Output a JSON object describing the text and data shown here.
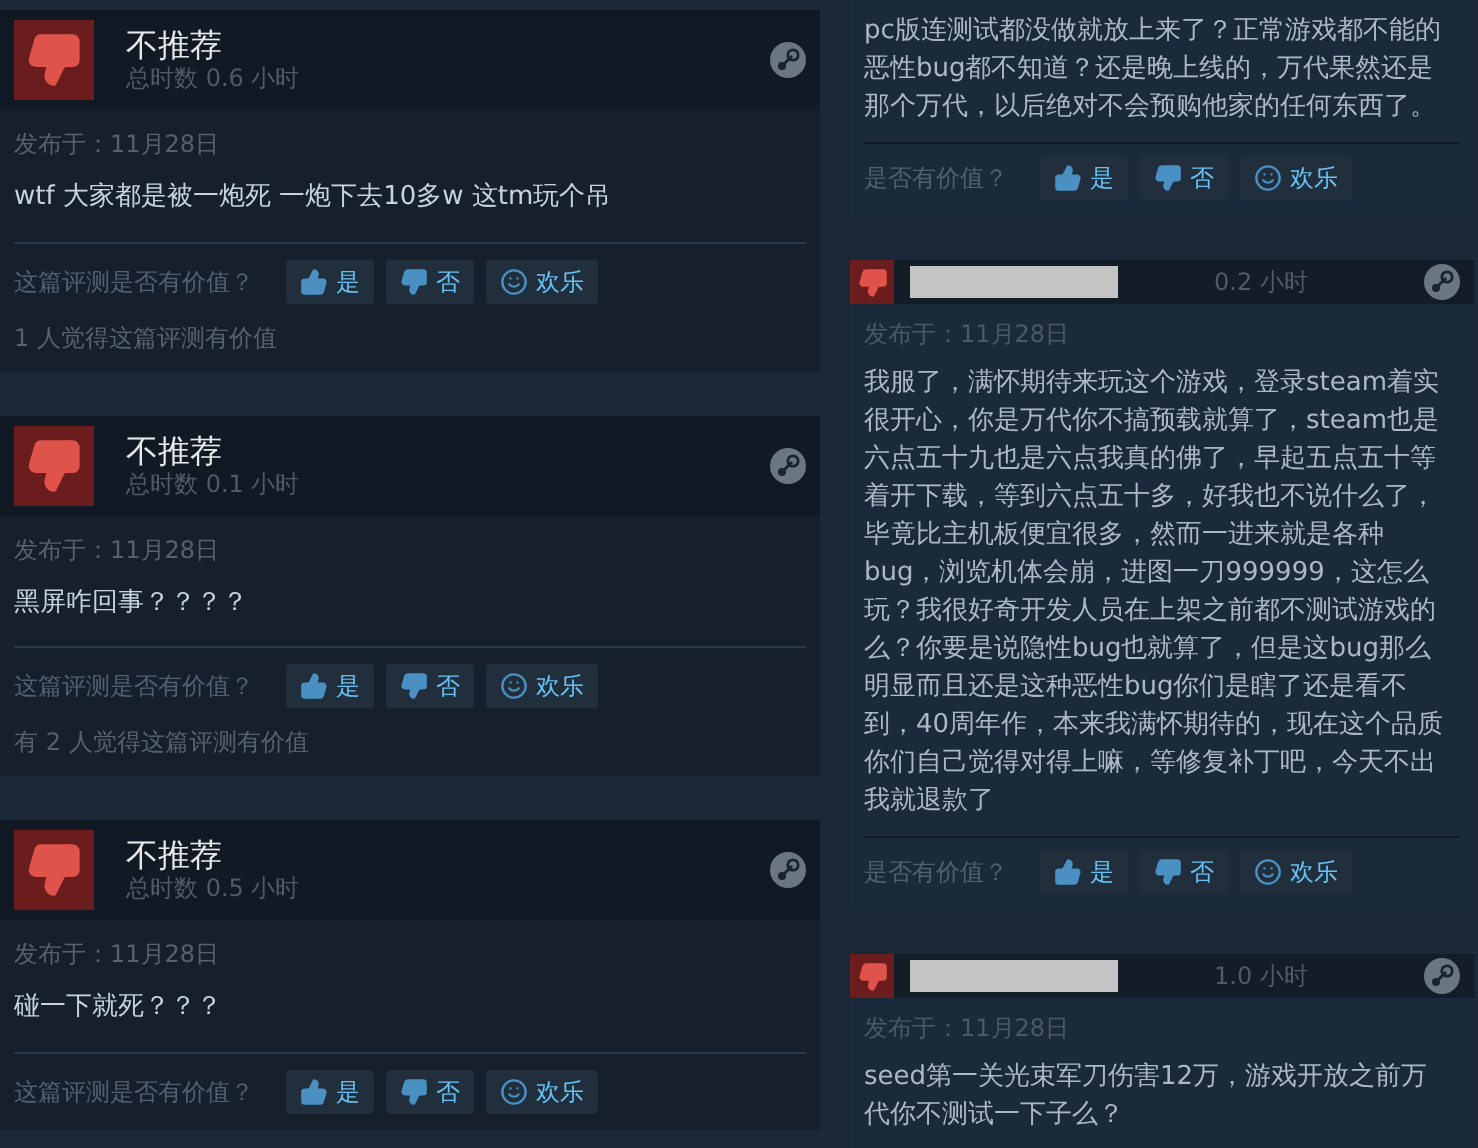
{
  "left_reviews": [
    {
      "verdict": "不推荐",
      "playtime": "总时数 0.6 小时",
      "posted": "发布于：11月28日",
      "text": "wtf 大家都是被一炮死 一炮下去10多w 这tm玩个吊",
      "helpful_prompt": "这篇评测是否有价值？",
      "votes": [
        {
          "kind": "up",
          "label": "是"
        },
        {
          "kind": "down",
          "label": "否"
        },
        {
          "kind": "funny",
          "label": "欢乐"
        }
      ],
      "helpful_count": "1 人觉得这篇评测有价值"
    },
    {
      "verdict": "不推荐",
      "playtime": "总时数 0.1 小时",
      "posted": "发布于：11月28日",
      "text": "黑屏咋回事？？？？",
      "helpful_prompt": "这篇评测是否有价值？",
      "votes": [
        {
          "kind": "up",
          "label": "是"
        },
        {
          "kind": "down",
          "label": "否"
        },
        {
          "kind": "funny",
          "label": "欢乐"
        }
      ],
      "helpful_count": "有 2 人觉得这篇评测有价值"
    },
    {
      "verdict": "不推荐",
      "playtime": "总时数 0.5 小时",
      "posted": "发布于：11月28日",
      "text": "碰一下就死？？？",
      "helpful_prompt": "这篇评测是否有价值？",
      "votes": [
        {
          "kind": "up",
          "label": "是"
        },
        {
          "kind": "down",
          "label": "否"
        },
        {
          "kind": "funny",
          "label": "欢乐"
        }
      ]
    }
  ],
  "right_reviews": [
    {
      "text": "pc版连测试都没做就放上来了？正常游戏都不能的恶性bug都不知道？还是晚上线的，万代果然还是那个万代，以后绝对不会预购他家的任何东西了。",
      "helpful_prompt": "是否有价值？",
      "votes": [
        {
          "kind": "up",
          "label": "是"
        },
        {
          "kind": "down",
          "label": "否"
        },
        {
          "kind": "funny",
          "label": "欢乐"
        }
      ]
    },
    {
      "hours": "0.2 小时",
      "posted": "发布于：11月28日",
      "text": "我服了，满怀期待来玩这个游戏，登录steam着实很开心，你是万代你不搞预载就算了，steam也是六点五十九也是六点我真的佛了，早起五点五十等着开下载，等到六点五十多，好我也不说什么了，毕竟比主机板便宜很多，然而一进来就是各种bug，浏览机体会崩，进图一刀999999，这怎么玩？我很好奇开发人员在上架之前都不测试游戏的么？你要是说隐性bug也就算了，但是这bug那么明显而且还是这种恶性bug你们是瞎了还是看不到，40周年作，本来我满怀期待的，现在这个品质你们自己觉得对得上嘛，等修复补丁吧，今天不出我就退款了",
      "helpful_prompt": "是否有价值？",
      "votes": [
        {
          "kind": "up",
          "label": "是"
        },
        {
          "kind": "down",
          "label": "否"
        },
        {
          "kind": "funny",
          "label": "欢乐"
        }
      ]
    },
    {
      "hours": "1.0 小时",
      "posted": "发布于：11月28日",
      "text": "seed第一关光束军刀伤害12万，游戏开放之前万代你不测试一下子么？"
    }
  ]
}
